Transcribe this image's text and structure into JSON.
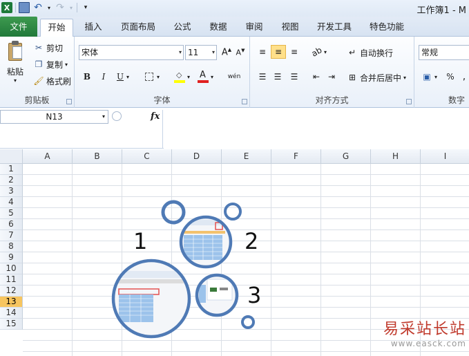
{
  "title": {
    "app_icon": "excel-icon",
    "text": "工作簿1 - M"
  },
  "tabs": [
    {
      "label": "文件",
      "name": "file"
    },
    {
      "label": "开始",
      "name": "home",
      "active": true
    },
    {
      "label": "插入",
      "name": "insert"
    },
    {
      "label": "页面布局",
      "name": "page-layout"
    },
    {
      "label": "公式",
      "name": "formulas"
    },
    {
      "label": "数据",
      "name": "data"
    },
    {
      "label": "审阅",
      "name": "review"
    },
    {
      "label": "视图",
      "name": "view"
    },
    {
      "label": "开发工具",
      "name": "developer"
    },
    {
      "label": "特色功能",
      "name": "featured"
    }
  ],
  "ribbon": {
    "clipboard": {
      "label": "剪贴板",
      "paste": "粘贴",
      "cut": "剪切",
      "copy": "复制",
      "format_painter": "格式刷"
    },
    "font": {
      "label": "字体",
      "font_name": "宋体",
      "font_size": "11",
      "bold": "B",
      "italic": "I",
      "underline": "U",
      "phonetic": "wén"
    },
    "alignment": {
      "label": "对齐方式",
      "wrap_text": "自动换行",
      "merge_center": "合并后居中"
    },
    "number": {
      "label": "数字",
      "format": "常规",
      "percent": "%"
    }
  },
  "formula_bar": {
    "name_box": "N13",
    "fx": "fx",
    "value": ""
  },
  "sheet": {
    "columns": [
      "A",
      "B",
      "C",
      "D",
      "E",
      "F",
      "G",
      "H",
      "I"
    ],
    "rows": [
      "1",
      "2",
      "3",
      "4",
      "5",
      "6",
      "7",
      "8",
      "9",
      "10",
      "11",
      "12",
      "13",
      "14",
      "15"
    ],
    "active_row": "13"
  },
  "annotations": {
    "n1": "1",
    "n2": "2",
    "n3": "3"
  },
  "watermark": {
    "text": "易采站长站",
    "url": "www.easck.com"
  },
  "colors": {
    "accent_blue": "#4f7ab5",
    "file_tab_green": "#21793a",
    "active_row": "#f7c55f"
  }
}
